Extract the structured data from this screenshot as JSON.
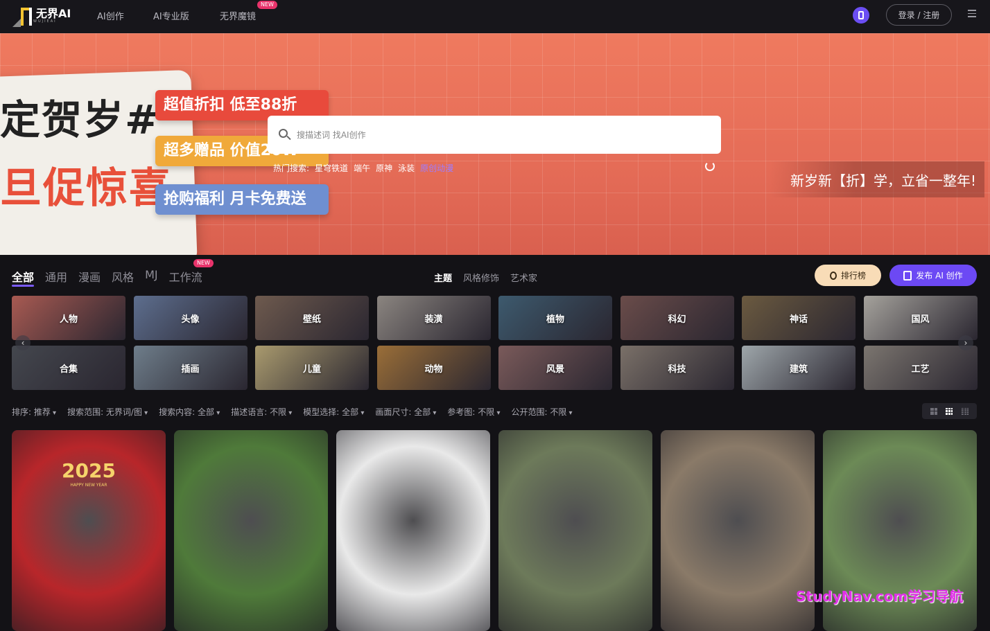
{
  "header": {
    "logo_text": "无界AI",
    "logo_sub": "WUJIEAI",
    "nav": [
      {
        "label": "AI创作"
      },
      {
        "label": "AI专业版"
      },
      {
        "label": "无界魔镜",
        "badge": "NEW"
      }
    ],
    "login_label": "登录 / 注册"
  },
  "banner": {
    "poster_line1": "定贺岁#",
    "poster_line2": "旦促惊喜",
    "ribbons": [
      "超值折扣  低至88折",
      "超多赠品  价值20W",
      "抢购福利  月卡免费送"
    ],
    "search_placeholder": "搜描述词 找AI创作",
    "hot_label": "热门搜索:",
    "hot_terms": [
      "星穹铁道",
      "端午",
      "原神",
      "泳装"
    ],
    "hot_highlight": "原创动漫",
    "slogan": "新岁新【折】学，立省一整年!"
  },
  "tabs": {
    "items": [
      "全部",
      "通用",
      "漫画",
      "风格",
      "MJ",
      "工作流"
    ],
    "new_badge": "NEW",
    "sub": [
      "主题",
      "风格修饰",
      "艺术家"
    ],
    "rank_label": "排行榜",
    "publish_label": "发布 AI 创作"
  },
  "categories": [
    {
      "label": "人物",
      "color": "#a85a52"
    },
    {
      "label": "头像",
      "color": "#5d6e8e"
    },
    {
      "label": "壁纸",
      "color": "#6e5a4e"
    },
    {
      "label": "装潢",
      "color": "#8b8580"
    },
    {
      "label": "植物",
      "color": "#3d5a6e"
    },
    {
      "label": "科幻",
      "color": "#6a4c4a"
    },
    {
      "label": "神话",
      "color": "#6b5a40"
    },
    {
      "label": "国风",
      "color": "#a5a29c"
    },
    {
      "label": "合集",
      "color": "#44474e"
    },
    {
      "label": "插画",
      "color": "#6e7d8a"
    },
    {
      "label": "儿童",
      "color": "#a99a6e"
    },
    {
      "label": "动物",
      "color": "#9a6e38"
    },
    {
      "label": "风景",
      "color": "#7a5a5a"
    },
    {
      "label": "科技",
      "color": "#7a7068"
    },
    {
      "label": "建筑",
      "color": "#9ea6aa"
    },
    {
      "label": "工艺",
      "color": "#7b756f"
    }
  ],
  "filters": [
    {
      "label": "排序: 推荐"
    },
    {
      "label": "搜索范围: 无界词/图"
    },
    {
      "label": "搜索内容: 全部"
    },
    {
      "label": "描述语言: 不限"
    },
    {
      "label": "模型选择: 全部"
    },
    {
      "label": "画面尺寸: 全部"
    },
    {
      "label": "参考图: 不限"
    },
    {
      "label": "公开范围: 不限"
    }
  ],
  "gallery": [
    {
      "name": "god-of-wealth",
      "bg": "#b8262a",
      "text": "2025",
      "sub": "HAPPY NEW YEAR"
    },
    {
      "name": "cherries",
      "bg": "#4f7a3a"
    },
    {
      "name": "robot-swing",
      "bg": "#e9e9e9"
    },
    {
      "name": "girl-portrait",
      "bg": "#6d7a5a"
    },
    {
      "name": "sweater-bear",
      "bg": "#8a7a68"
    },
    {
      "name": "cat-window",
      "bg": "#6c8a56"
    }
  ],
  "watermark": "StudyNav.com学习导航"
}
